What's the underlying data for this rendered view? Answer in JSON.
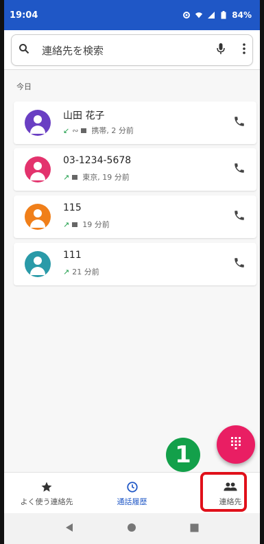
{
  "status_bar": {
    "time": "19:04",
    "battery": "84%"
  },
  "search": {
    "placeholder": "連絡先を検索"
  },
  "section_label": "今日",
  "calls": [
    {
      "name": "山田 花子",
      "detail": "携帯, 2 分前",
      "avatar_color": "#6a3fc3",
      "direction": "incoming",
      "has_voicemail": true,
      "has_sim": true
    },
    {
      "name": "03-1234-5678",
      "detail": "東京, 19 分前",
      "avatar_color": "#e3336d",
      "direction": "outgoing",
      "has_voicemail": false,
      "has_sim": true
    },
    {
      "name": "115",
      "detail": "19 分前",
      "avatar_color": "#f07f1a",
      "direction": "outgoing",
      "has_voicemail": false,
      "has_sim": true
    },
    {
      "name": "111",
      "detail": "21 分前",
      "avatar_color": "#2a9aa8",
      "direction": "outgoing",
      "has_voicemail": false,
      "has_sim": false
    }
  ],
  "badge_number": "1",
  "bottom_nav": {
    "favorites": "よく使う連絡先",
    "recents": "通話履歴",
    "contacts": "連絡先"
  },
  "colors": {
    "accent": "#1f57c6",
    "fab": "#e91e63",
    "highlight": "#e0101a",
    "badge": "#13a04a"
  },
  "icons": {
    "search": "search-icon",
    "mic": "microphone-icon",
    "menu": "more-vert-icon",
    "call": "phone-icon",
    "dialpad": "dialpad-icon",
    "favorites": "star-icon",
    "recents": "clock-icon",
    "contacts": "people-icon"
  }
}
